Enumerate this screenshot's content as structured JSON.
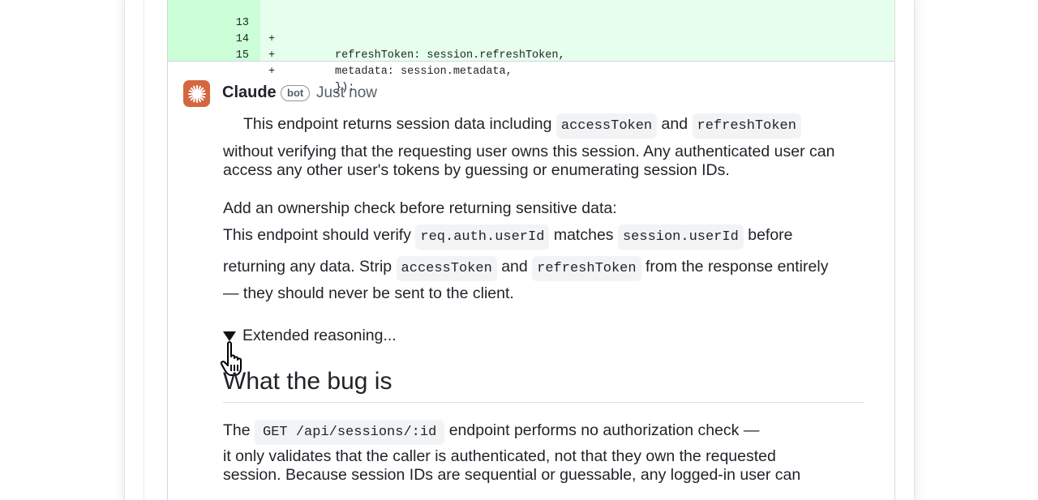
{
  "diff": {
    "lines": [
      {
        "num": "13",
        "sign": "+",
        "code": "refreshToken: session.refreshToken,"
      },
      {
        "num": "14",
        "sign": "+",
        "code": "metadata: session.metadata,"
      },
      {
        "num": "15",
        "sign": "+",
        "code": "});"
      }
    ]
  },
  "comment": {
    "author": "Claude",
    "badge": "bot",
    "timestamp": "Just now",
    "p1": {
      "a": "This endpoint returns session data including",
      "code1": "accessToken",
      "b": "and",
      "code2": "refreshToken",
      "line2": "without verifying that the requesting user owns this session. Any authenticated user can",
      "line3": "access any other user's tokens by guessing or enumerating session IDs."
    },
    "p2": {
      "line1": "Add an ownership check before returning sensitive data:",
      "a": "This endpoint should verify",
      "code1": "req.auth.userId",
      "b": "matches",
      "code2": "session.userId",
      "c": "before",
      "d": "returning any data. Strip",
      "code3": "accessToken",
      "e": "and",
      "code4": "refreshToken",
      "f": "from the response entirely",
      "line4": "— they should never be sent to the client."
    },
    "reasoning_label": "Extended reasoning...",
    "heading": "What the bug is",
    "p3": {
      "a": "The",
      "code1": "GET /api/sessions/:id",
      "b": "endpoint performs no authorization check —",
      "line2": "it only validates that the caller is authenticated, not that they own the requested",
      "line3": "session. Because session IDs are sequential or guessable, any logged-in user can"
    }
  },
  "colors": {
    "avatar": "#d4673f",
    "diff_add_bg": "#e6ffec",
    "diff_gutter_bg": "#ccffd8"
  }
}
